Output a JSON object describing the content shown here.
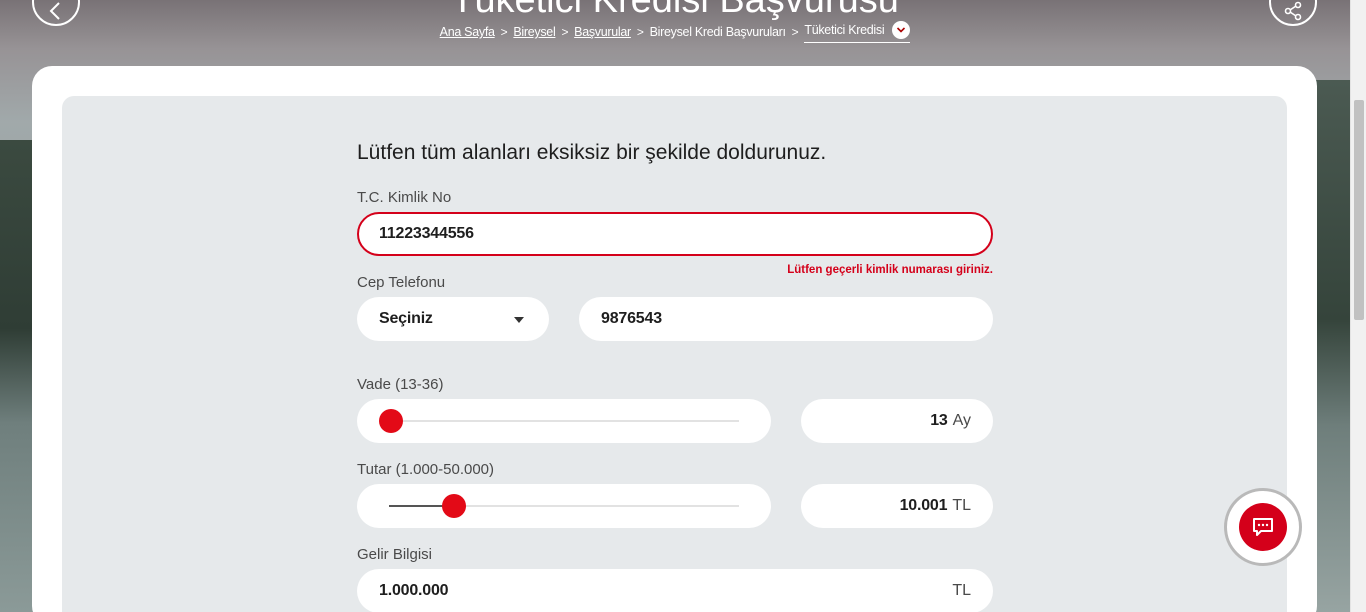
{
  "header": {
    "title": "Tüketici Kredisi Başvurusu",
    "breadcrumb": [
      {
        "label": "Ana Sayfa"
      },
      {
        "label": "Bireysel"
      },
      {
        "label": "Başvurular"
      },
      {
        "label": "Bireysel Kredi Başvuruları"
      },
      {
        "label": "Tüketici Kredisi"
      }
    ]
  },
  "form": {
    "intro": "Lütfen tüm alanları eksiksiz bir şekilde doldurunuz.",
    "tc": {
      "label": "T.C. Kimlik No",
      "value": "11223344556",
      "error": "Lütfen geçerli kimlik numarası giriniz."
    },
    "phone": {
      "label": "Cep Telefonu",
      "prefix_selected": "Seçiniz",
      "value": "9876543"
    },
    "term": {
      "label": "Vade (13-36)",
      "value": "13",
      "unit": "Ay",
      "slider_fraction": 0.0
    },
    "amount": {
      "label": "Tutar (1.000-50.000)",
      "value": "10.001",
      "unit": "TL",
      "slider_fraction": 0.18
    },
    "income": {
      "label": "Gelir Bilgisi",
      "value": "1.000.000",
      "unit": "TL"
    }
  },
  "icons": {
    "back": "chevron-left-icon",
    "share": "share-icon",
    "breadcrumb_toggle": "chevron-down-icon",
    "chat": "chat-icon"
  },
  "colors": {
    "accent": "#e30a17",
    "error": "#d4001a",
    "panel": "#e6e9eb"
  }
}
